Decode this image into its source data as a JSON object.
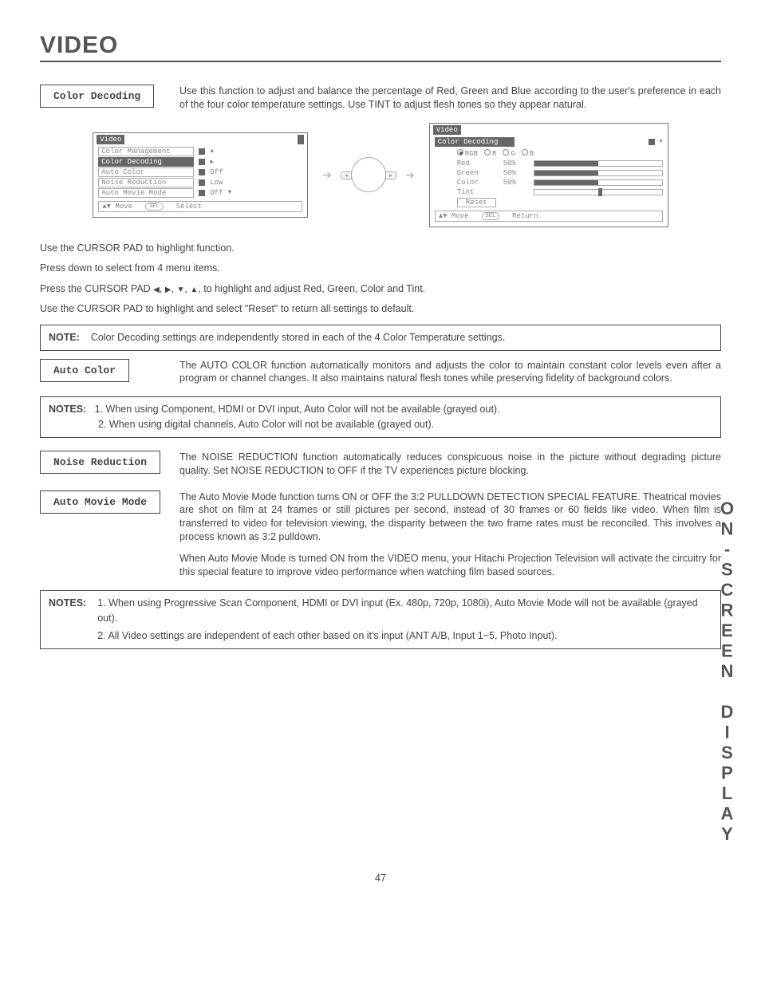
{
  "page": {
    "title": "VIDEO",
    "number": "47",
    "sideTab": "ON-SCREEN DISPLAY"
  },
  "sections": {
    "colorDecoding": {
      "label": "Color Decoding",
      "text": "Use this function to adjust and balance the percentage of Red, Green and Blue according to the user's preference in each of the four color temperature settings.  Use TINT to adjust flesh tones so they appear natural."
    },
    "autoColor": {
      "label": "Auto Color",
      "text": "The AUTO COLOR function automatically monitors and adjusts the color to maintain constant color levels even after a program or channel changes. It also maintains natural flesh tones while preserving fidelity of background colors."
    },
    "noiseReduction": {
      "label": "Noise Reduction",
      "text": "The NOISE REDUCTION function automatically reduces conspicuous noise in the picture without degrading picture quality.  Set NOISE REDUCTION to OFF if the TV experiences picture blocking."
    },
    "autoMovieMode": {
      "label": "Auto Movie Mode",
      "text1": "The Auto Movie Mode function turns ON or OFF the 3:2 PULLDOWN DETECTION SPECIAL FEATURE. Theatrical movies are shot on film at 24 frames or still pictures per second, instead of 30 frames or 60 fields like video.  When film is transferred to video for television viewing, the disparity between the two frame rates must be reconciled.  This involves a process known as 3:2 pulldown.",
      "text2": "When Auto Movie Mode is turned ON from the VIDEO menu, your Hitachi Projection Television will activate the circuitry for this special feature to improve video performance when watching film based sources."
    }
  },
  "instructions": {
    "l1": "Use the CURSOR PAD to highlight function.",
    "l2": "Press down to select from 4 menu items.",
    "l3a": "Press the CURSOR PAD ",
    "l3b": ", to highlight and adjust Red, Green, Color and Tint.",
    "l4": "Use the CURSOR PAD to highlight and select \"Reset\" to return all settings to default."
  },
  "note1": {
    "label": "NOTE:",
    "text": "Color Decoding settings are independently stored in each of the 4 Color Temperature settings."
  },
  "notes2": {
    "label": "NOTES:",
    "i1": "1. When using Component, HDMI or DVI input, Auto Color will not be available (grayed out).",
    "i2": "2. When using digital channels, Auto Color will not be available (grayed out)."
  },
  "notes3": {
    "label": "NOTES:",
    "i1": "1. When using Progressive Scan Component, HDMI or DVI input (Ex. 480p, 720p, 1080i), Auto Movie Mode will not be available (grayed out).",
    "i2": "2. All Video settings are independent of each other based on it's input (ANT A/B, Input 1~5, Photo Input)."
  },
  "osd1": {
    "title": "Video",
    "items": [
      {
        "label": "Color Management",
        "val": "",
        "arrow": "▲"
      },
      {
        "label": "Color Decoding",
        "val": "",
        "selected": true,
        "arrow": "▶"
      },
      {
        "label": "Auto Color",
        "val": "Off"
      },
      {
        "label": "Noise Reduction",
        "val": "Low"
      },
      {
        "label": "Auto Movie Mode",
        "val": "Off",
        "arrow": "▼"
      }
    ],
    "foot": {
      "move": "Move",
      "sel": "SEL",
      "action": "Select"
    }
  },
  "osd2": {
    "title": "Video",
    "subtitle": "Color Decoding",
    "radios": [
      "RGB",
      "R",
      "G",
      "B"
    ],
    "rows": [
      {
        "label": "Red",
        "pct": "50%"
      },
      {
        "label": "Green",
        "pct": "50%"
      },
      {
        "label": "Color",
        "pct": "50%"
      },
      {
        "label": "Tint",
        "pct": ""
      }
    ],
    "reset": "Reset",
    "foot": {
      "move": "Move",
      "sel": "SEL",
      "action": "Return"
    }
  }
}
